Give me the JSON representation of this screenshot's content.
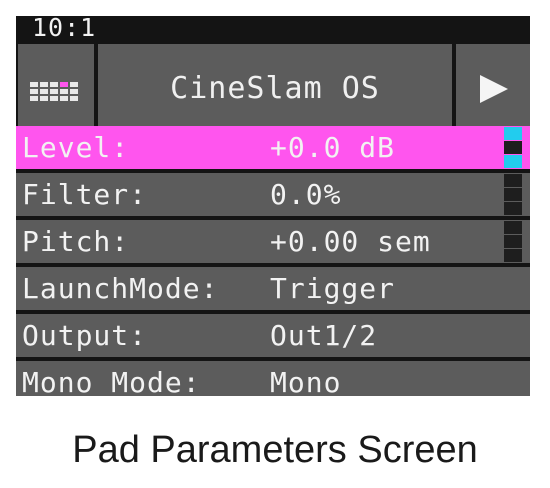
{
  "status": {
    "text": "10:1"
  },
  "header": {
    "grid_icon": "pads-grid-icon",
    "title": "CineSlam OS",
    "play_icon": "play-icon"
  },
  "params": [
    {
      "label": "Level:",
      "value": "+0.0 dB",
      "selected": true
    },
    {
      "label": "Filter:",
      "value": "0.0%",
      "selected": false
    },
    {
      "label": "Pitch:",
      "value": "+0.00 sem",
      "selected": false
    },
    {
      "label": "LaunchMode:",
      "value": "Trigger",
      "selected": false
    },
    {
      "label": "Output:",
      "value": "Out1/2",
      "selected": false
    },
    {
      "label": "Mono Mode:",
      "value": "Mono",
      "selected": false
    }
  ],
  "colors": {
    "selected_row": "#ff55ee",
    "row_bg": "#5c5c5c",
    "scroll_thumb": "#22ccee",
    "screen_bg": "#141414"
  },
  "caption": "Pad Parameters Screen"
}
